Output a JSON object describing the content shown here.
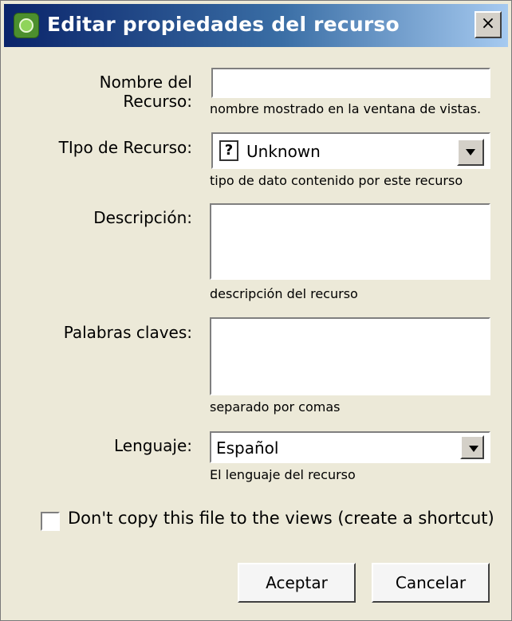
{
  "window": {
    "title": "Editar propiedades del recurso",
    "close_glyph": "×"
  },
  "form": {
    "resource_name": {
      "label": "Nombre del Recurso:",
      "value": "",
      "hint": "nombre mostrado en la ventana de vistas."
    },
    "resource_type": {
      "label": "TIpo de Recurso:",
      "icon": "unknown-file-icon",
      "icon_glyph": "?",
      "value": "Unknown",
      "hint": "tipo de dato contenido por este recurso"
    },
    "description": {
      "label": "Descripción:",
      "value": "",
      "hint": "descripción del recurso"
    },
    "keywords": {
      "label": "Palabras claves:",
      "value": "",
      "hint": "separado por comas"
    },
    "language": {
      "label": "Lenguaje:",
      "value": "Español",
      "hint": "El lenguaje del recurso"
    }
  },
  "checkbox": {
    "label": "Don't copy this file to the views (create a shortcut)",
    "checked": false
  },
  "buttons": {
    "accept": "Aceptar",
    "cancel": "Cancelar"
  },
  "colors": {
    "titlebar_start": "#0a246a",
    "titlebar_end": "#a6caf0",
    "dialog_bg": "#ece9d8"
  }
}
